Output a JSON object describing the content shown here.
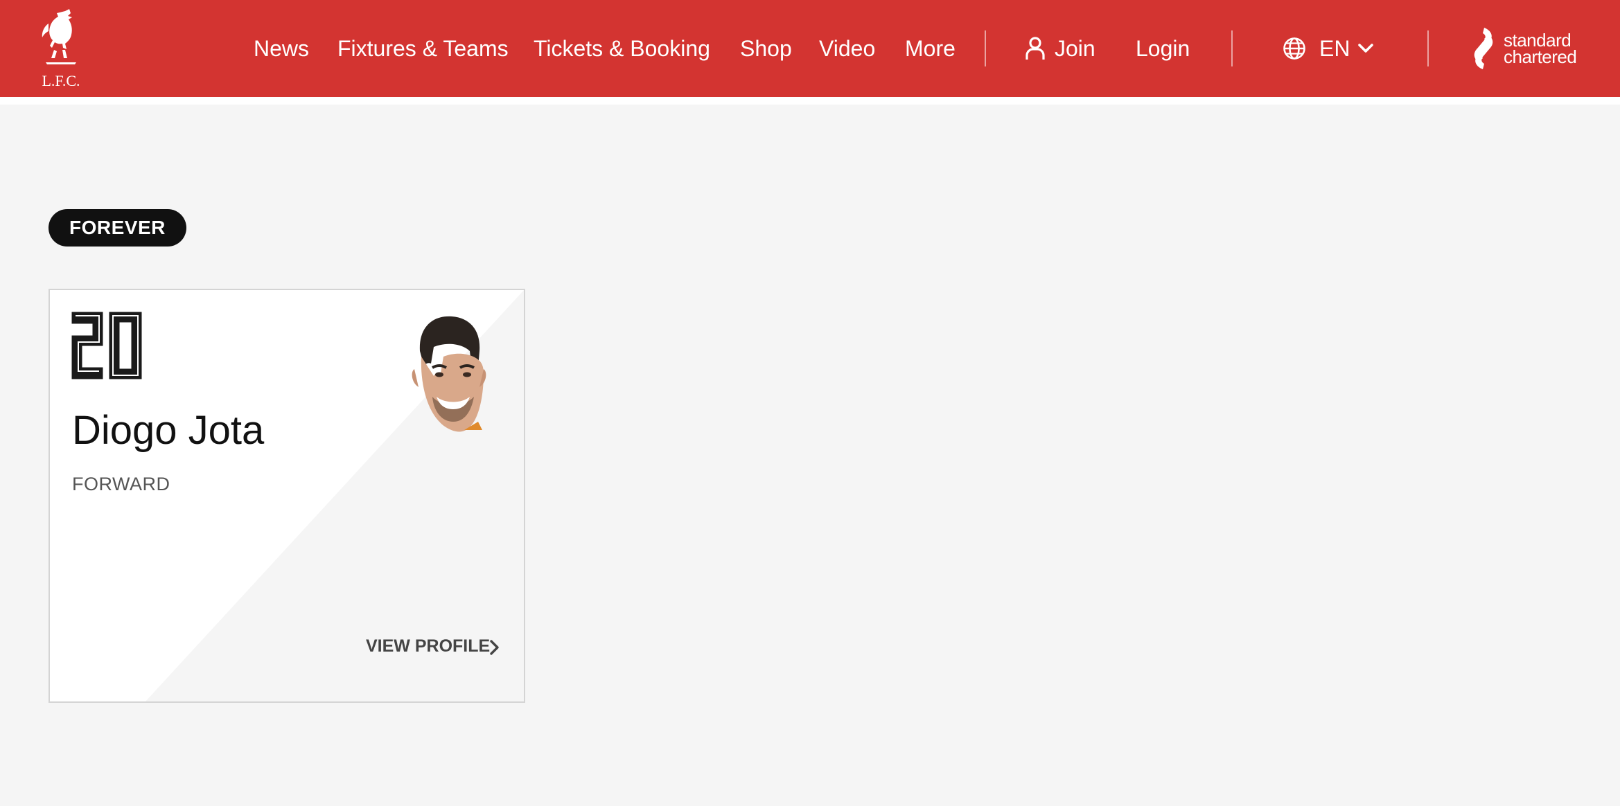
{
  "header": {
    "background": "#d33431",
    "crest_label": "L.F.C.",
    "nav": [
      {
        "label": "News"
      },
      {
        "label": "Fixtures & Teams"
      },
      {
        "label": "Tickets & Booking"
      },
      {
        "label": "Shop"
      },
      {
        "label": "Video"
      },
      {
        "label": "More"
      }
    ],
    "join_label": "Join",
    "login_label": "Login",
    "language_label": "EN",
    "sponsor_line1": "standard",
    "sponsor_line2": "chartered",
    "icons": {
      "join": "user-icon",
      "language": "globe-icon",
      "dropdown": "chevron-down-icon",
      "crest": "liverbird-crest-icon",
      "sponsor": "standard-chartered-logo-icon"
    }
  },
  "section": {
    "badge_label": "FOREVER"
  },
  "player_card": {
    "number": "20",
    "name": "Diogo Jota",
    "position": "FORWARD",
    "cta_label": "VIEW PROFILE",
    "cta_icon": "chevron-right-icon",
    "accent": "#f5f5f5"
  }
}
